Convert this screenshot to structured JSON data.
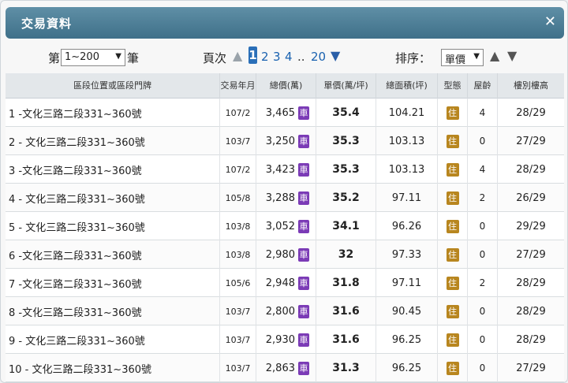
{
  "dialog": {
    "title": "交易資料",
    "close_symbol": "✕"
  },
  "controls": {
    "page_prefix": "第",
    "range_value": "1~200",
    "page_suffix": "筆",
    "page_label": "頁次",
    "page_prev_symbol": "▲",
    "pages": [
      "1",
      "2",
      "3",
      "4"
    ],
    "current_page": "1",
    "ellipsis": "..",
    "last_page": "20",
    "page_next_symbol": "▼",
    "sort_label": "排序：",
    "sort_value": "單價",
    "sort_asc_symbol": "▲",
    "sort_desc_symbol": "▼"
  },
  "table": {
    "headers": {
      "address": "區段位置或區段門牌",
      "ym": "交易年月",
      "total": "總價(萬)",
      "unit": "單價(萬/坪)",
      "area": "總面積(坪)",
      "type": "型態",
      "age": "屋齡",
      "floor": "樓別樓高"
    },
    "car_badge": "車",
    "type_badge": "住",
    "rows": [
      {
        "idx": "1",
        "addr": "1 -文化三路二段331~360號",
        "ym": "107/2",
        "total": "3,465",
        "unit": "35.4",
        "area": "104.21",
        "age": "4",
        "floor": "28/29"
      },
      {
        "idx": "2",
        "addr": "2 - 文化三路二段331~360號",
        "ym": "103/7",
        "total": "3,250",
        "unit": "35.3",
        "area": "103.13",
        "age": "0",
        "floor": "27/29"
      },
      {
        "idx": "3",
        "addr": "3 -文化三路二段331~360號",
        "ym": "107/2",
        "total": "3,423",
        "unit": "35.3",
        "area": "103.13",
        "age": "4",
        "floor": "28/29"
      },
      {
        "idx": "4",
        "addr": "4 - 文化三路二段331~360號",
        "ym": "105/8",
        "total": "3,288",
        "unit": "35.2",
        "area": "97.11",
        "age": "2",
        "floor": "26/29"
      },
      {
        "idx": "5",
        "addr": "5 - 文化三路二段331~360號",
        "ym": "103/8",
        "total": "3,052",
        "unit": "34.1",
        "area": "96.26",
        "age": "0",
        "floor": "29/29"
      },
      {
        "idx": "6",
        "addr": "6 -文化三路二段331~360號",
        "ym": "103/8",
        "total": "2,980",
        "unit": "32",
        "area": "97.33",
        "age": "0",
        "floor": "27/29"
      },
      {
        "idx": "7",
        "addr": "7 -文化三路二段331~360號",
        "ym": "105/6",
        "total": "2,948",
        "unit": "31.8",
        "area": "97.11",
        "age": "2",
        "floor": "28/29"
      },
      {
        "idx": "8",
        "addr": "8 -文化三路二段331~360號",
        "ym": "103/7",
        "total": "2,800",
        "unit": "31.6",
        "area": "90.45",
        "age": "0",
        "floor": "28/29"
      },
      {
        "idx": "9",
        "addr": "9 - 文化三路二段331~360號",
        "ym": "103/7",
        "total": "2,930",
        "unit": "31.6",
        "area": "96.25",
        "age": "0",
        "floor": "28/29"
      },
      {
        "idx": "10",
        "addr": "10 - 文化三路二段331~360號",
        "ym": "103/7",
        "total": "2,863",
        "unit": "31.3",
        "area": "96.25",
        "age": "0",
        "floor": "27/29"
      }
    ]
  },
  "colors": {
    "title_bar": "#4a7a92",
    "car_badge": "#7b3bb6",
    "type_badge": "#b8861f",
    "page_link": "#1a62b0"
  }
}
